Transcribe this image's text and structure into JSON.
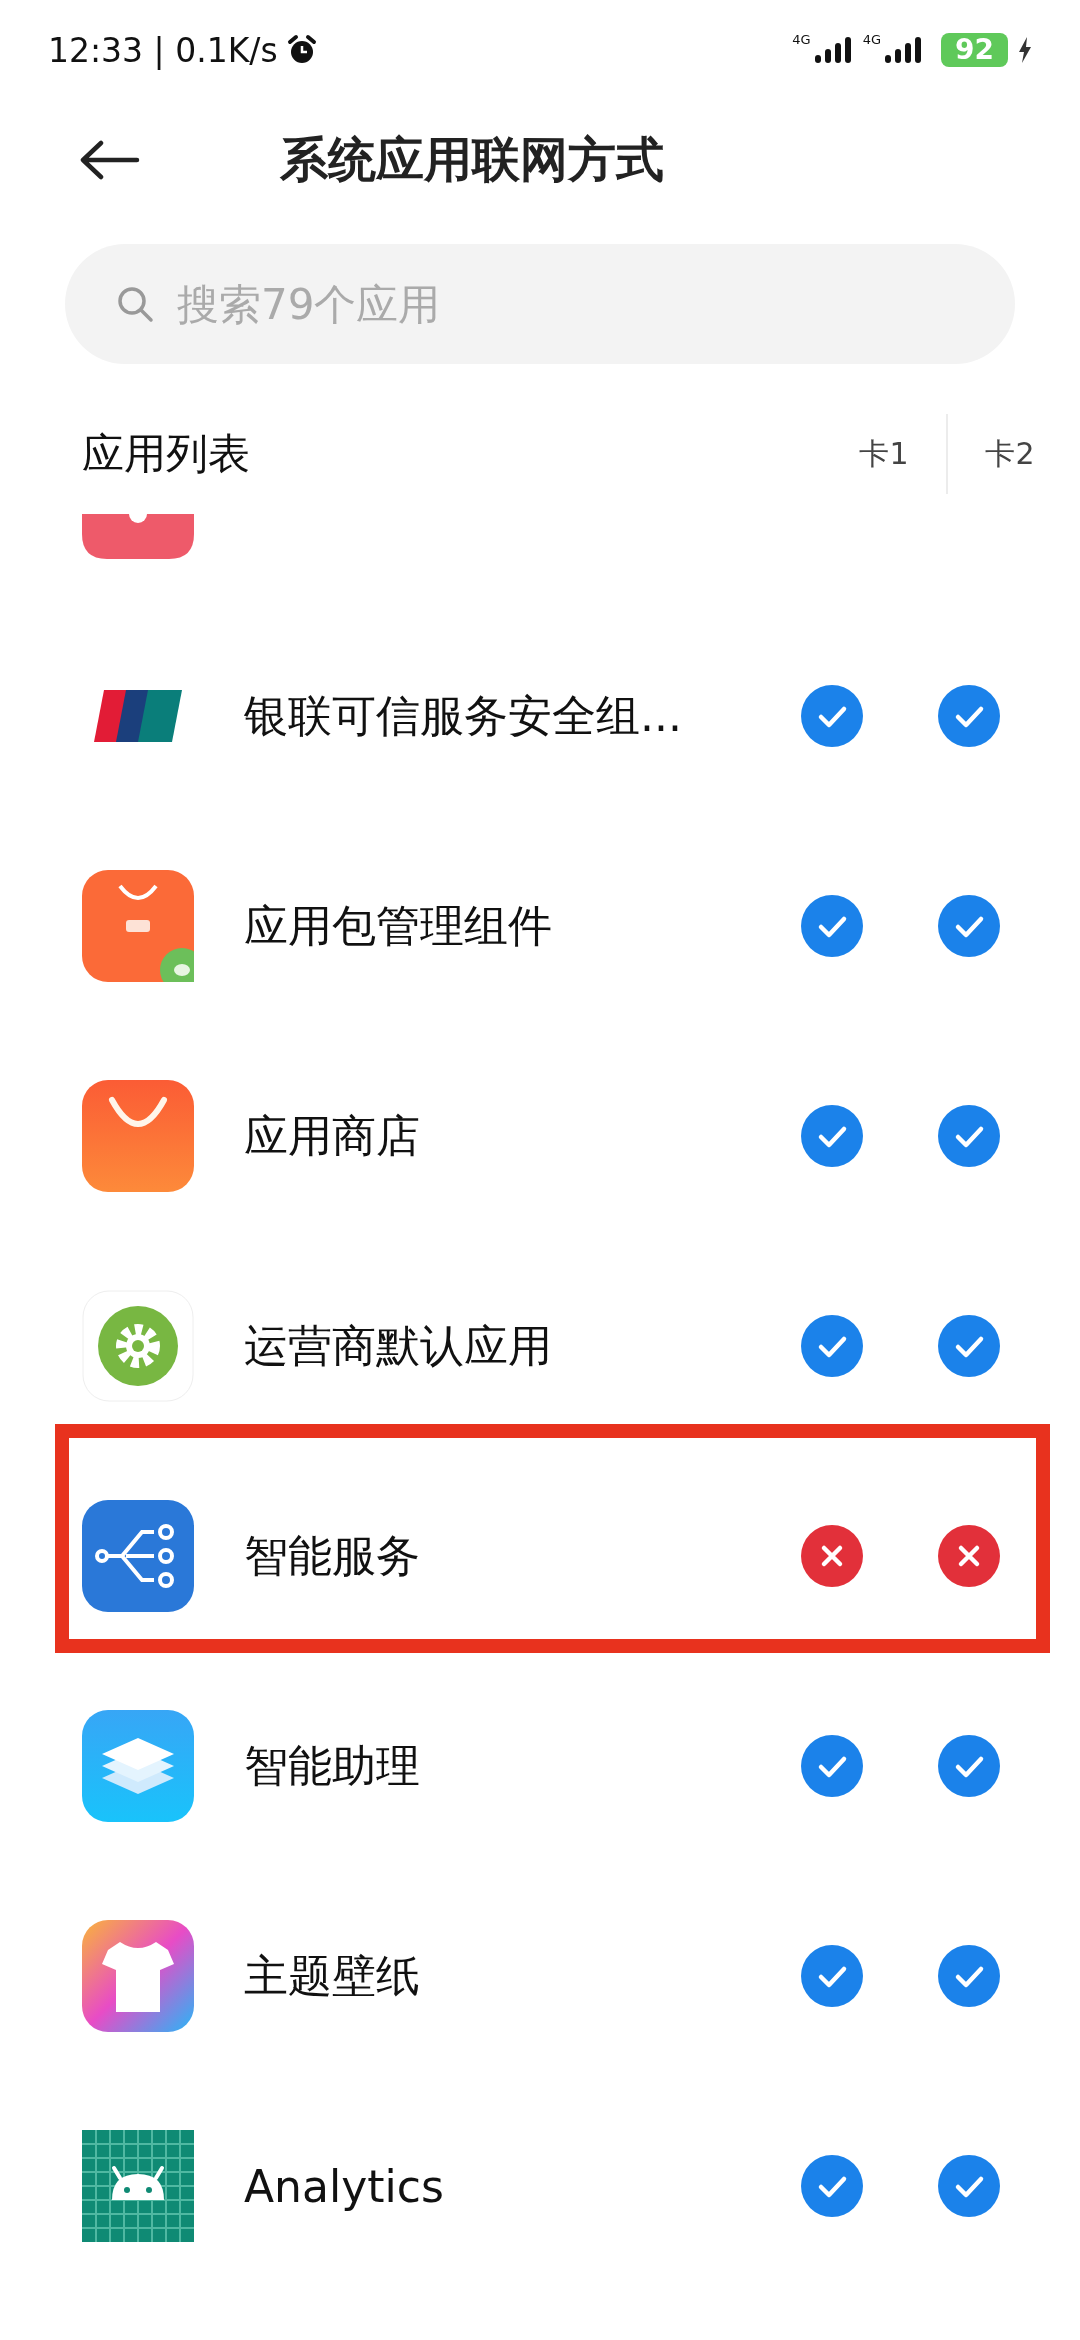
{
  "status_bar": {
    "time": "12:33 | 0.1K/s",
    "sims": [
      {
        "network": "4G"
      },
      {
        "network": "4G"
      }
    ],
    "battery": "92"
  },
  "header": {
    "title": "系统应用联网方式"
  },
  "search": {
    "placeholder": "搜索79个应用"
  },
  "list": {
    "title": "应用列表",
    "columns": [
      "卡1",
      "卡2"
    ]
  },
  "apps": [
    {
      "name": "银联可信服务安全组...",
      "sim1": true,
      "sim2": true,
      "highlighted": false
    },
    {
      "name": "应用包管理组件",
      "sim1": true,
      "sim2": true,
      "highlighted": false
    },
    {
      "name": "应用商店",
      "sim1": true,
      "sim2": true,
      "highlighted": false
    },
    {
      "name": "运营商默认应用",
      "sim1": true,
      "sim2": true,
      "highlighted": false
    },
    {
      "name": "智能服务",
      "sim1": false,
      "sim2": false,
      "highlighted": true
    },
    {
      "name": "智能助理",
      "sim1": true,
      "sim2": true,
      "highlighted": false
    },
    {
      "name": "主题壁纸",
      "sim1": true,
      "sim2": true,
      "highlighted": false
    },
    {
      "name": "Analytics",
      "sim1": true,
      "sim2": true,
      "highlighted": false
    }
  ]
}
